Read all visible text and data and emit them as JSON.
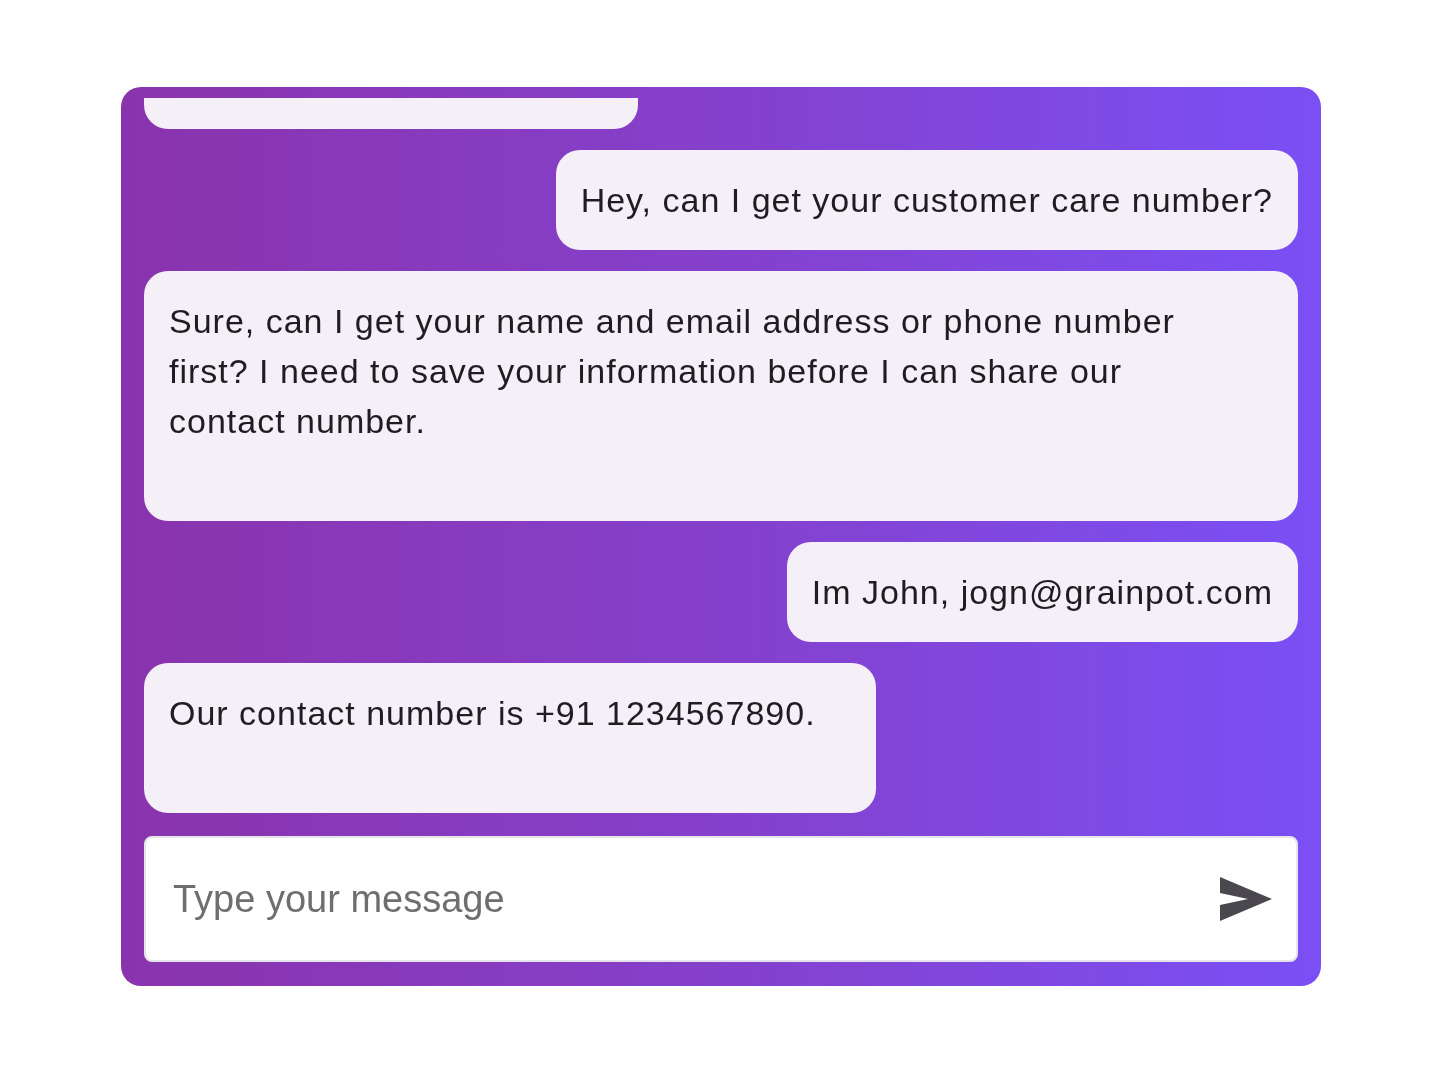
{
  "messages": [
    {
      "kind": "bot",
      "partial": true
    },
    {
      "kind": "user",
      "text": "Hey, can I get your customer care number?"
    },
    {
      "kind": "bot",
      "text": "Sure, can I get your name and email address or phone number first? I need to save your information before I can share our contact number."
    },
    {
      "kind": "user",
      "text": "Im John, jogn@grainpot.com"
    },
    {
      "kind": "bot",
      "text": "Our contact number is +91 1234567890."
    }
  ],
  "composer": {
    "placeholder": "Type your message"
  }
}
